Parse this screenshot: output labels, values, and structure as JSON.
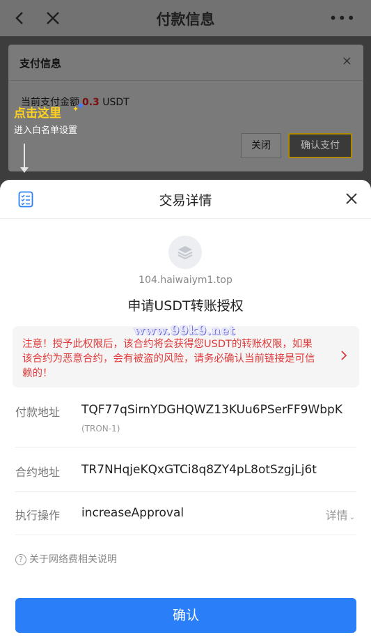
{
  "topbar": {
    "title": "付款信息",
    "back_icon": "chevron-left-icon",
    "close_icon": "close-icon",
    "more_label": "•••"
  },
  "pay_dialog": {
    "title": "支付信息",
    "close_glyph": "×",
    "amount_label": "当前支付金额",
    "amount_value": "0.3",
    "amount_unit": "USDT",
    "close_button": "关闭",
    "confirm_button": "确认支付"
  },
  "annotation": {
    "headline": "点击这里",
    "sub": "进入白名单设置"
  },
  "sheet": {
    "title": "交易详情",
    "dapp_host": "104.haiwaiym1.top",
    "action": "申请USDT转账授权",
    "watermark": "www.99k9.net",
    "warning": "注意！授予此权限后，该合约将会获得您USDT的转账权限，如果该合约为恶意合约，会有被盗的风险，请务必确认当前链接是可信赖的！",
    "rows": [
      {
        "key": "付款地址",
        "value": "TQF77qSirnYDGHQWZ13KUu6PSerFF9WbpK",
        "sub": "(TRON-1)"
      },
      {
        "key": "合约地址",
        "value": "TR7NHqjeKQxGTCi8q8ZY4pL8otSzgjLj6t"
      },
      {
        "key": "执行操作",
        "value": "increaseApproval",
        "detail": "详情"
      }
    ],
    "fee_note": "关于网络费相关说明",
    "confirm": "确认"
  },
  "colors": {
    "primary": "#2a7ef8",
    "warning_text": "#e03b3b",
    "annotation": "#ffd21f"
  }
}
